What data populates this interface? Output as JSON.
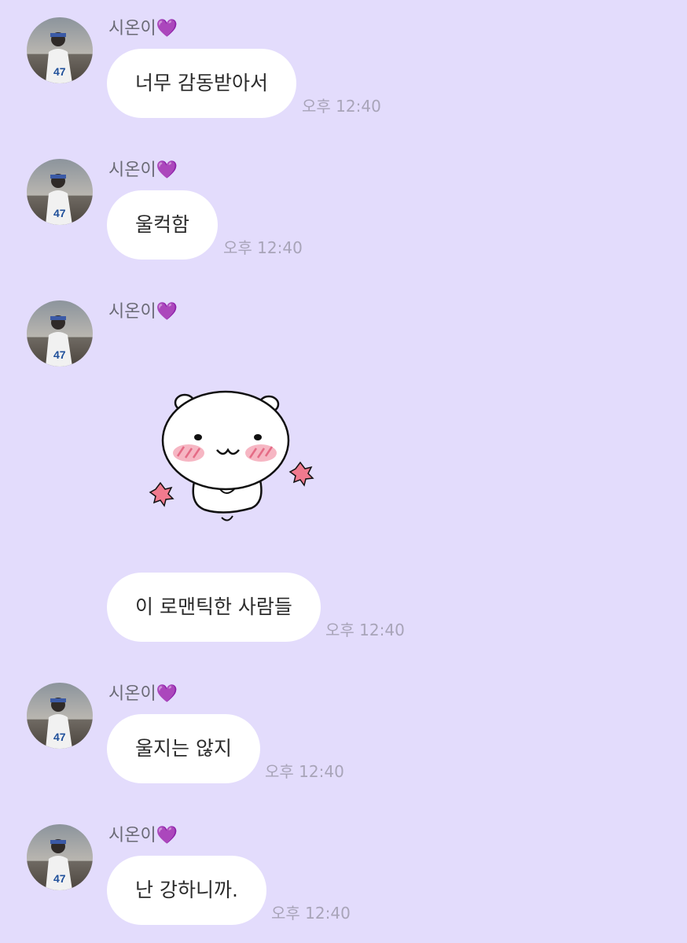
{
  "chat": {
    "messages": [
      {
        "sender": "시온이",
        "text": "너무 감동받아서",
        "time": "오후 12:40"
      },
      {
        "sender": "시온이",
        "text": "울컥함",
        "time": "오후 12:40"
      },
      {
        "sender": "시온이",
        "sticker": "blushing-white-bear-sticker",
        "text": "이 로맨틱한 사람들",
        "time": "오후 12:40"
      },
      {
        "sender": "시온이",
        "text": "울지는 않지",
        "time": "오후 12:40"
      },
      {
        "sender": "시온이",
        "text": "난 강하니까.",
        "time": "오후 12:40"
      }
    ]
  },
  "colors": {
    "background": "#e3dcfc",
    "bubble": "#ffffff",
    "heart": "#8a2be2",
    "time": "#a8a4b8"
  }
}
